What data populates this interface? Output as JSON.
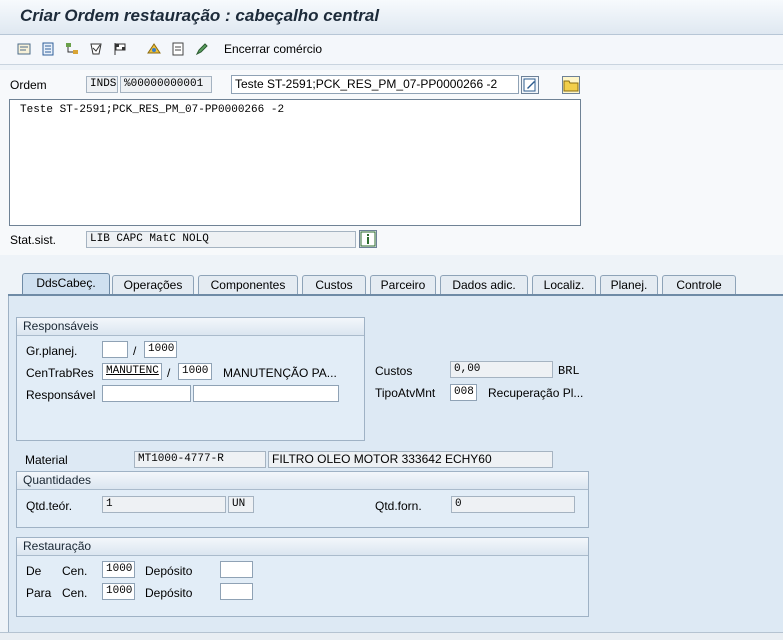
{
  "title": "Criar Ordem restauração : cabeçalho central",
  "toolbar": {
    "end_commerce": "Encerrar comércio"
  },
  "header": {
    "order_label": "Ordem",
    "order_type": "INDS",
    "order_number": "%00000000001",
    "order_desc": "Teste ST-2591;PCK_RES_PM_07-PP0000266 -2",
    "long_text": "Teste ST-2591;PCK_RES_PM_07-PP0000266 -2",
    "status_label": "Stat.sist.",
    "status_value": "LIB  CAPC MatC NOLQ"
  },
  "tabs": [
    "DdsCabeç.",
    "Operações",
    "Componentes",
    "Custos",
    "Parceiro",
    "Dados adic.",
    "Localiz.",
    "Planej.",
    "Controle"
  ],
  "responsaveis": {
    "title": "Responsáveis",
    "gr_planej_label": "Gr.planej.",
    "gr_planej_value": "",
    "gr_planej_center": "1000",
    "centrab_label": "CenTrabRes",
    "centrab_value": "MANUTENC",
    "centrab_center": "1000",
    "centrab_desc": "MANUTENÇÃO PA...",
    "responsavel_label": "Responsável",
    "responsavel_value": "",
    "responsavel_desc": "",
    "slash": "/"
  },
  "custos": {
    "custos_label": "Custos",
    "custos_value": "0,00",
    "currency": "BRL",
    "tipo_label": "TipoAtvMnt",
    "tipo_value": "008",
    "tipo_desc": "Recuperação Pl..."
  },
  "material": {
    "label": "Material",
    "code": "MT1000-4777-R",
    "desc": "FILTRO OLEO MOTOR 333642 ECHY60"
  },
  "quantidades": {
    "title": "Quantidades",
    "qtd_teor_label": "Qtd.teór.",
    "qtd_teor_value": "1",
    "unit": "UN",
    "qtd_forn_label": "Qtd.forn.",
    "qtd_forn_value": "0"
  },
  "restauracao": {
    "title": "Restauração",
    "de_label": "De",
    "para_label": "Para",
    "cen_label": "Cen.",
    "de_cen": "1000",
    "para_cen": "1000",
    "deposito_label": "Depósito",
    "de_deposito": "",
    "para_deposito": ""
  }
}
